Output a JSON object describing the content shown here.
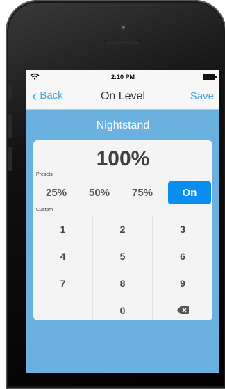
{
  "status": {
    "time": "2:10 PM"
  },
  "nav": {
    "back_label": "Back",
    "title": "On Level",
    "save_label": "Save"
  },
  "device": {
    "name": "Nightstand"
  },
  "level": {
    "display": "100%"
  },
  "presets": {
    "label": "Presets",
    "items": [
      {
        "label": "25%"
      },
      {
        "label": "50%"
      },
      {
        "label": "75%"
      },
      {
        "label": "On",
        "selected": true
      }
    ]
  },
  "custom": {
    "label": "Custom",
    "keys": [
      "1",
      "2",
      "3",
      "4",
      "5",
      "6",
      "7",
      "8",
      "9",
      "",
      "0",
      "backspace-icon"
    ]
  },
  "colors": {
    "accent": "#4aa4e0",
    "background": "#6ab1e0",
    "selected_preset": "#0a8ef0"
  }
}
